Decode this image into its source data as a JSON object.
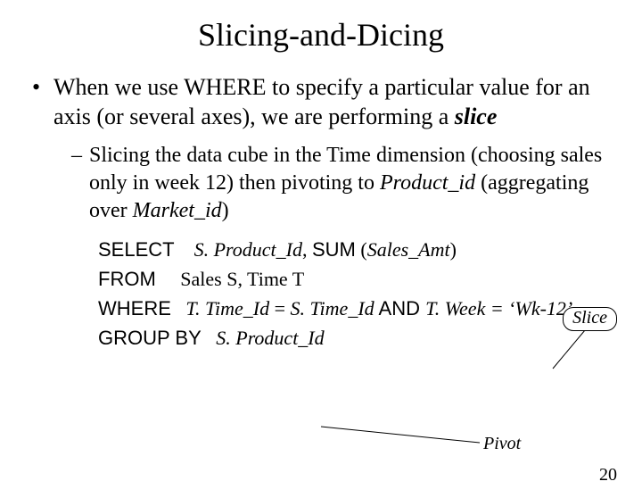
{
  "title": "Slicing-and-Dicing",
  "bullet1": {
    "pre": "When we use ",
    "where_kw": "WHERE",
    "mid": " to specify a particular value for an axis (or several axes), we are performing a ",
    "slice": "slice"
  },
  "bullet2": {
    "pre": "Slicing the data cube in the Time dimension (choosing sales only in week 12)  then pivoting to ",
    "product_id": "Product_id",
    "mid": " (aggregating over ",
    "market_id": "Market_id",
    "post": ")"
  },
  "sql": {
    "select": {
      "kw": "SELECT",
      "col1": "S. Product_Id",
      "comma": ",  ",
      "sum_kw": "SUM",
      "sum_arg_open": " (",
      "sum_arg": "Sales_Amt",
      "sum_arg_close": ")"
    },
    "from": {
      "kw": "FROM",
      "body": "Sales S, Time T"
    },
    "where": {
      "kw": "WHERE",
      "c1a": "T. Time_Id",
      "eq": " = ",
      "c1b": "S. Time_Id",
      "and_kw": "  AND  ",
      "c2a": "T. Week",
      "c2b": " = ‘Wk-12’"
    },
    "group": {
      "kw": "GROUP BY",
      "col": "S. Product_Id"
    }
  },
  "annotations": {
    "slice": "Slice",
    "pivot": "Pivot"
  },
  "page_number": "20"
}
